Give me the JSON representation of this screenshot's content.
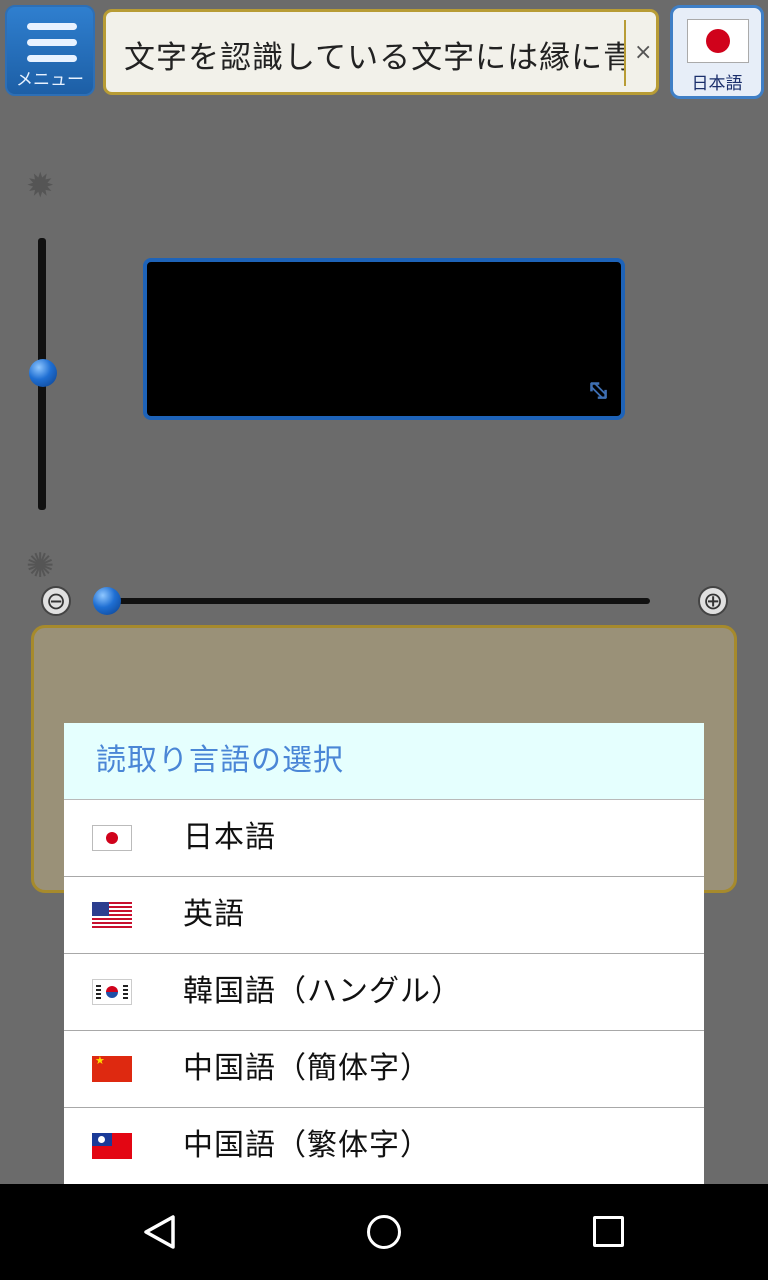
{
  "header": {
    "menu_label": "メニュー",
    "search_text": "文字を認識している文字には縁に青",
    "clear_symbol": "×",
    "language_label": "日本語"
  },
  "camera": {
    "brightness_high_icon": "sun-icon",
    "brightness_low_icon": "half-sun-icon",
    "brightness_level": 0.5,
    "zoom_level": 0.0,
    "zoom_out_symbol": "⊖",
    "zoom_in_symbol": "⊕"
  },
  "dialog": {
    "title": "読取り言語の選択",
    "languages": [
      {
        "label": "日本語",
        "flag": "japan-flag-icon"
      },
      {
        "label": "英語",
        "flag": "usa-flag-icon"
      },
      {
        "label": "韓国語（ハングル）",
        "flag": "korea-flag-icon"
      },
      {
        "label": "中国語（簡体字）",
        "flag": "china-flag-icon"
      },
      {
        "label": "中国語（繁体字）",
        "flag": "taiwan-flag-icon"
      }
    ]
  },
  "colors": {
    "accent_blue": "#1e63b8",
    "gold_border": "#b89c35",
    "dialog_title": "#4a86d6"
  }
}
